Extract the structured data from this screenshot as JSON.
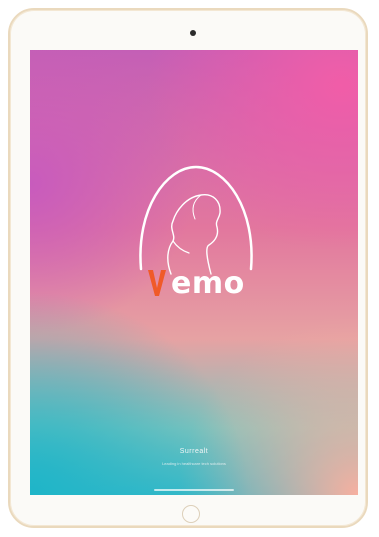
{
  "app": {
    "brand_name": "emo",
    "brand_full": "Vemo",
    "footer_brand": "Surrealt",
    "footer_subtitle": "Leading in healthcare tech solutions"
  },
  "icons": {
    "logo": "woman-profile-arc-icon",
    "brand_mark": "v-letter-icon",
    "camera": "front-camera-icon",
    "home": "home-button-icon"
  },
  "colors": {
    "brand_v": "#f05a28",
    "text": "#ffffff",
    "gradient_top_left": "#c45fb6",
    "gradient_top_right": "#f15da8",
    "gradient_bottom_left": "#1fb5c8",
    "gradient_bottom_right": "#f7b0a0"
  }
}
